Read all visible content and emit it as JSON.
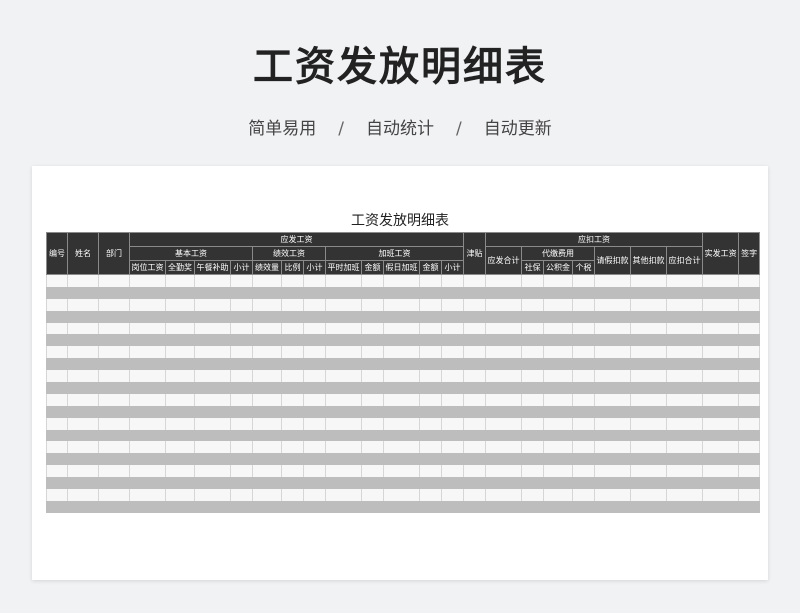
{
  "header": {
    "title": "工资发放明细表",
    "subtitle_items": [
      "简单易用",
      "自动统计",
      "自动更新"
    ],
    "separator": "/"
  },
  "sheet": {
    "title": "工资发放明细表",
    "columns": {
      "id": "编号",
      "name": "姓名",
      "dept": "部门",
      "gross": "应发工资",
      "basic": "基本工资",
      "post_wage": "岗位工资",
      "attendance_bonus": "全勤奖",
      "lunch_subsidy": "午餐补助",
      "basic_subtotal": "小计",
      "performance": "绩效工资",
      "performance_amount": "绩效量",
      "ratio": "比例",
      "performance_subtotal": "小计",
      "overtime": "加班工资",
      "weekday_ot": "平时加班",
      "weekday_ot_amount": "金额",
      "holiday_ot": "假日加班",
      "holiday_ot_amount": "金额",
      "overtime_subtotal": "小计",
      "allowance": "津贴",
      "deductions": "应扣工资",
      "gross_total": "应发合计",
      "withholding": "代缴费用",
      "social_insurance": "社保",
      "housing_fund": "公积金",
      "income_tax": "个税",
      "leave_deduction": "请假扣款",
      "other_deduction": "其他扣款",
      "deduction_total": "应扣合计",
      "net_pay": "实发工资",
      "signature": "签字"
    },
    "row_count": 20
  }
}
